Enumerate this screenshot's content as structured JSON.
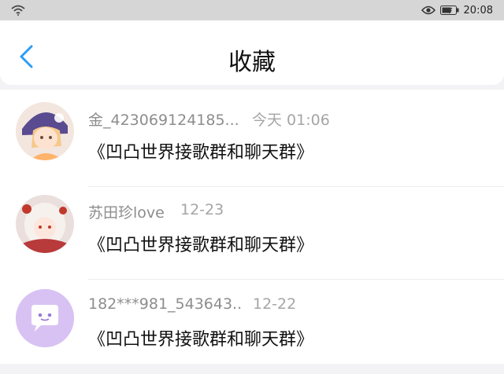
{
  "status_bar": {
    "time": "20:08",
    "icons": [
      "wifi-icon",
      "eye-icon",
      "battery-icon"
    ]
  },
  "header": {
    "title": "收藏",
    "back_icon": "chevron-left-icon"
  },
  "colors": {
    "accent": "#2a9df4",
    "avatar3_bg": "#d8c2f3"
  },
  "items": [
    {
      "name": "金_423069124185...",
      "time": "今天 01:06",
      "content": "《凹凸世界接歌群和聊天群》"
    },
    {
      "name": "苏田珍love",
      "time": "12-23",
      "content": "《凹凸世界接歌群和聊天群》"
    },
    {
      "name": "182***981_543643..",
      "time": "12-22",
      "content": "《凹凸世界接歌群和聊天群》"
    }
  ]
}
